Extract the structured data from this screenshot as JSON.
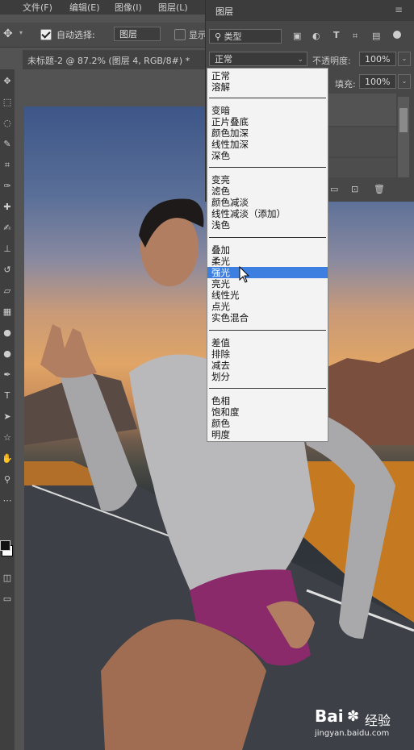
{
  "menubar": {
    "items": [
      {
        "label": "文件(F)"
      },
      {
        "label": "编辑(E)"
      },
      {
        "label": "图像(I)"
      },
      {
        "label": "图层(L)"
      }
    ]
  },
  "options_bar": {
    "auto_select_label": "自动选择:",
    "auto_select_checked": true,
    "auto_select_target": "图层",
    "show_label": "显示"
  },
  "document": {
    "tab_title": "未标题-2 @ 87.2% (图层 4, RGB/8#) *"
  },
  "layers_panel": {
    "title": "图层",
    "filter_kind": "类型",
    "blend_mode": "正常",
    "opacity_label": "不透明度:",
    "opacity_value": "100%",
    "fill_label": "填充:",
    "fill_value": "100%"
  },
  "blend_menu": {
    "groups": [
      {
        "items": [
          "正常",
          "溶解"
        ]
      },
      {
        "items": [
          "变暗",
          "正片叠底",
          "颜色加深",
          "线性加深",
          "深色"
        ]
      },
      {
        "items": [
          "变亮",
          "滤色",
          "颜色减淡",
          "线性减淡（添加）",
          "浅色"
        ]
      },
      {
        "items": [
          "叠加",
          "柔光",
          "强光",
          "亮光",
          "线性光",
          "点光",
          "实色混合"
        ]
      },
      {
        "items": [
          "差值",
          "排除",
          "减去",
          "划分"
        ]
      },
      {
        "items": [
          "色相",
          "饱和度",
          "颜色",
          "明度"
        ]
      }
    ],
    "highlighted": "强光"
  },
  "watermark": {
    "brand": "Bai",
    "brand_suffix": "经验",
    "url": "jingyan.baidu.com"
  },
  "colors": {
    "highlight": "#3d7fe0",
    "panel_bg": "#474747",
    "menu_bg": "#f3f3f3"
  }
}
